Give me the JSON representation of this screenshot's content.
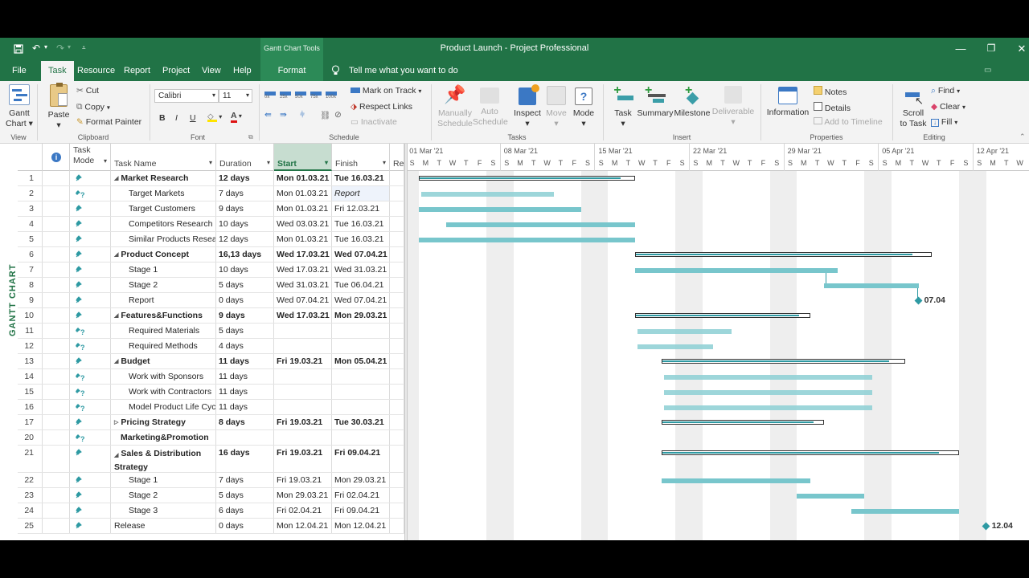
{
  "window": {
    "title": "Product Launch  -  Project Professional",
    "context_group": "Gantt Chart Tools"
  },
  "tabs": [
    "File",
    "Task",
    "Resource",
    "Report",
    "Project",
    "View",
    "Help",
    "Format"
  ],
  "tell_me": "Tell me what you want to do",
  "ribbon": {
    "view": {
      "gantt_label_1": "Gantt",
      "gantt_label_2": "Chart",
      "group": "View"
    },
    "clipboard": {
      "paste": "Paste",
      "cut": "Cut",
      "copy": "Copy",
      "format_painter": "Format Painter",
      "group": "Clipboard"
    },
    "font": {
      "family": "Calibri",
      "size": "11",
      "bold": "B",
      "italic": "I",
      "underline": "U",
      "group": "Font"
    },
    "schedule": {
      "mark_on_track": "Mark on Track",
      "respect_links": "Respect Links",
      "inactivate": "Inactivate",
      "group": "Schedule",
      "pct": [
        "0x",
        "25x",
        "50x",
        "75x",
        "100x"
      ]
    },
    "tasks": {
      "manual_1": "Manually",
      "manual_2": "Schedule",
      "auto_1": "Auto",
      "auto_2": "Schedule",
      "inspect": "Inspect",
      "move": "Move",
      "mode": "Mode",
      "group": "Tasks"
    },
    "insert": {
      "task": "Task",
      "summary": "Summary",
      "milestone": "Milestone",
      "deliverable": "Deliverable",
      "group": "Insert"
    },
    "properties": {
      "information": "Information",
      "notes": "Notes",
      "details": "Details",
      "add_to_timeline": "Add to Timeline",
      "group": "Properties"
    },
    "editing": {
      "scroll_1": "Scroll",
      "scroll_2": "to Task",
      "find": "Find",
      "clear": "Clear",
      "fill": "Fill",
      "group": "Editing"
    }
  },
  "side_label": "GANTT CHART",
  "columns": {
    "task_mode_1": "Task",
    "task_mode_2": "Mode",
    "task_name": "Task Name",
    "duration": "Duration",
    "start": "Start",
    "finish": "Finish",
    "resources": "Res"
  },
  "tasks": [
    {
      "id": "1",
      "name": "Market Research",
      "duration": "12 days",
      "start": "Mon 01.03.21",
      "finish": "Tue 16.03.21",
      "summary": true,
      "level": 0,
      "mode": "manual"
    },
    {
      "id": "2",
      "name": "Target Markets",
      "duration": "7 days",
      "start": "Mon 01.03.21",
      "finish": "Report",
      "summary": false,
      "level": 1,
      "mode": "q"
    },
    {
      "id": "3",
      "name": "Target Customers",
      "duration": "9 days",
      "start": "Mon 01.03.21",
      "finish": "Fri 12.03.21",
      "summary": false,
      "level": 1,
      "mode": "manual"
    },
    {
      "id": "4",
      "name": "Competitors Research",
      "duration": "10 days",
      "start": "Wed 03.03.21",
      "finish": "Tue 16.03.21",
      "summary": false,
      "level": 1,
      "mode": "manual"
    },
    {
      "id": "5",
      "name": "Similar Products Research",
      "duration": "12 days",
      "start": "Mon 01.03.21",
      "finish": "Tue 16.03.21",
      "summary": false,
      "level": 1,
      "mode": "manual"
    },
    {
      "id": "6",
      "name": "Product Concept",
      "duration": "16,13 days",
      "start": "Wed 17.03.21",
      "finish": "Wed 07.04.21",
      "summary": true,
      "level": 0,
      "mode": "manual"
    },
    {
      "id": "7",
      "name": "Stage 1",
      "duration": "10 days",
      "start": "Wed 17.03.21",
      "finish": "Wed 31.03.21",
      "summary": false,
      "level": 1,
      "mode": "manual"
    },
    {
      "id": "8",
      "name": "Stage 2",
      "duration": "5 days",
      "start": "Wed 31.03.21",
      "finish": "Tue 06.04.21",
      "summary": false,
      "level": 1,
      "mode": "manual"
    },
    {
      "id": "9",
      "name": "Report",
      "duration": "0 days",
      "start": "Wed 07.04.21",
      "finish": "Wed 07.04.21",
      "summary": false,
      "level": 1,
      "mode": "manual"
    },
    {
      "id": "10",
      "name": "Features&Functions",
      "duration": "9 days",
      "start": "Wed 17.03.21",
      "finish": "Mon 29.03.21",
      "summary": true,
      "level": 0,
      "mode": "manual"
    },
    {
      "id": "11",
      "name": "Required Materials",
      "duration": "5 days",
      "start": "",
      "finish": "",
      "summary": false,
      "level": 1,
      "mode": "q"
    },
    {
      "id": "12",
      "name": "Required Methods",
      "duration": "4 days",
      "start": "",
      "finish": "",
      "summary": false,
      "level": 1,
      "mode": "q"
    },
    {
      "id": "13",
      "name": "Budget",
      "duration": "11 days",
      "start": "Fri 19.03.21",
      "finish": "Mon 05.04.21",
      "summary": true,
      "level": 0,
      "mode": "manual"
    },
    {
      "id": "14",
      "name": "Work with Sponsors",
      "duration": "11 days",
      "start": "",
      "finish": "",
      "summary": false,
      "level": 1,
      "mode": "q"
    },
    {
      "id": "15",
      "name": "Work with Contractors",
      "duration": "11 days",
      "start": "",
      "finish": "",
      "summary": false,
      "level": 1,
      "mode": "q"
    },
    {
      "id": "16",
      "name": "Model Product Life Cycle",
      "duration": "11 days",
      "start": "",
      "finish": "",
      "summary": false,
      "level": 1,
      "mode": "q"
    },
    {
      "id": "17",
      "name": "Pricing Strategy",
      "duration": "8 days",
      "start": "Fri 19.03.21",
      "finish": "Tue 30.03.21",
      "summary": true,
      "level": 0,
      "mode": "manual",
      "collapsed": true
    },
    {
      "id": "20",
      "name": "Marketing&Promotion",
      "duration": "",
      "start": "",
      "finish": "",
      "summary": true,
      "level": 0,
      "mode": "q",
      "nochevron": true
    },
    {
      "id": "21",
      "name": "Sales & Distribution Strategy",
      "duration": "16 days",
      "start": "Fri 19.03.21",
      "finish": "Fri 09.04.21",
      "summary": true,
      "level": 0,
      "mode": "manual",
      "tall": true
    },
    {
      "id": "22",
      "name": "Stage 1",
      "duration": "7 days",
      "start": "Fri 19.03.21",
      "finish": "Mon 29.03.21",
      "summary": false,
      "level": 1,
      "mode": "manual"
    },
    {
      "id": "23",
      "name": "Stage 2",
      "duration": "5 days",
      "start": "Mon 29.03.21",
      "finish": "Fri 02.04.21",
      "summary": false,
      "level": 1,
      "mode": "manual"
    },
    {
      "id": "24",
      "name": "Stage 3",
      "duration": "6 days",
      "start": "Fri 02.04.21",
      "finish": "Fri 09.04.21",
      "summary": false,
      "level": 1,
      "mode": "manual"
    },
    {
      "id": "25",
      "name": "Release",
      "duration": "0 days",
      "start": "Mon 12.04.21",
      "finish": "Mon 12.04.21",
      "summary": false,
      "level": 0,
      "mode": "manual"
    }
  ],
  "timescale": {
    "weeks": [
      "01 Mar '21",
      "08 Mar '21",
      "15 Mar '21",
      "22 Mar '21",
      "29 Mar '21",
      "05 Apr '21",
      "12 Apr '21"
    ],
    "day_letters": [
      "S",
      "M",
      "T",
      "W",
      "T",
      "F",
      "S"
    ]
  },
  "milestone_labels": {
    "report": "07.04",
    "release": "12.04"
  },
  "colors": {
    "brand": "#217346",
    "bar": "#78c6cc",
    "summary_fill": "#2e9aa3"
  }
}
